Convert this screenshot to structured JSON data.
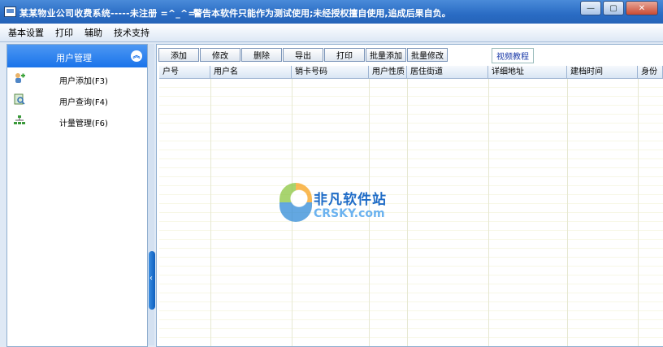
{
  "window": {
    "title": "某某物业公司收费系统-----未注册 =^_^=",
    "warning": "警告本软件只能作为测试使用;未经授权擅自使用,追成后果自负。",
    "controls": {
      "minimize": "—",
      "maximize": "▢",
      "close": "✕"
    }
  },
  "menubar": {
    "items": [
      {
        "label": "基本设置"
      },
      {
        "label": "打印"
      },
      {
        "label": "辅助"
      },
      {
        "label": "技术支持"
      }
    ]
  },
  "sidebar": {
    "header": "用户管理",
    "items": [
      {
        "label": "用户添加(F3)",
        "icon": "user-add-icon"
      },
      {
        "label": "用户查询(F4)",
        "icon": "user-search-icon"
      },
      {
        "label": "计量管理(F6)",
        "icon": "meter-tree-icon"
      }
    ]
  },
  "toolbar": {
    "buttons": [
      "添加",
      "修改",
      "删除",
      "导出",
      "打印",
      "批量添加",
      "批量修改"
    ],
    "video": "视频教程"
  },
  "table": {
    "columns": [
      "户号",
      "用户名",
      "销卡号码",
      "用户性质",
      "居住街道",
      "详细地址",
      "建档时间",
      "身份"
    ]
  },
  "watermark": {
    "cn": "非凡软件站",
    "en": "CRSKY.com"
  },
  "colors": {
    "header_blue": "#1a73ea",
    "title_blue": "#2a6cc4"
  }
}
